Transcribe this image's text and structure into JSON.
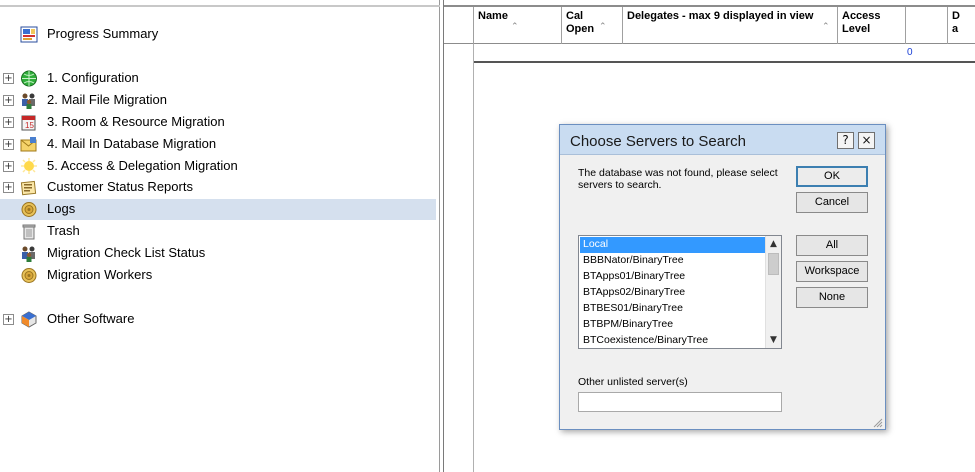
{
  "navigator": {
    "items": [
      {
        "label": "Progress Summary",
        "icon": "progress-summary-icon",
        "expandable": false,
        "selected": false
      },
      {
        "label": "1. Configuration",
        "icon": "configuration-globe-icon",
        "expandable": true,
        "selected": false
      },
      {
        "label": "2. Mail File Migration",
        "icon": "mail-file-people-icon",
        "expandable": true,
        "selected": false
      },
      {
        "label": "3. Room & Resource Migration",
        "icon": "room-resource-icon",
        "expandable": true,
        "selected": false
      },
      {
        "label": "4. Mail In Database Migration",
        "icon": "mail-in-database-icon",
        "expandable": true,
        "selected": false
      },
      {
        "label": "5. Access & Delegation Migration",
        "icon": "access-delegation-icon",
        "expandable": true,
        "selected": false
      },
      {
        "label": "Customer Status Reports",
        "icon": "status-reports-icon",
        "expandable": true,
        "selected": false
      },
      {
        "label": "Logs",
        "icon": "logs-icon",
        "expandable": false,
        "selected": true
      },
      {
        "label": "Trash",
        "icon": "trash-icon",
        "expandable": false,
        "selected": false
      },
      {
        "label": "Migration Check List Status",
        "icon": "check-list-people-icon",
        "expandable": false,
        "selected": false
      },
      {
        "label": "Migration Workers",
        "icon": "migration-workers-icon",
        "expandable": false,
        "selected": false
      },
      {
        "label": "Other Software",
        "icon": "other-software-icon",
        "expandable": true,
        "selected": false
      }
    ],
    "expander_symbol": "+",
    "selection_color": "#d5e0ee"
  },
  "grid": {
    "columns": [
      {
        "label": "Name"
      },
      {
        "label": "Cal Open"
      },
      {
        "label": "Delegates - max 9 displayed in view"
      },
      {
        "label": "Access Level"
      },
      {
        "label": ""
      },
      {
        "label": "D a"
      }
    ],
    "sort_arrow": "⌃",
    "total_value": "0"
  },
  "dialog": {
    "title": "Choose Servers to Search",
    "help_button": "?",
    "close_button": "×",
    "message": "The database was not found, please select servers to search.",
    "buttons": {
      "ok": "OK",
      "cancel": "Cancel",
      "all": "All",
      "workspace": "Workspace",
      "none": "None"
    },
    "servers": [
      "Local",
      "BBBNator/BinaryTree",
      "BTApps01/BinaryTree",
      "BTApps02/BinaryTree",
      "BTBES01/BinaryTree",
      "BTBPM/BinaryTree",
      "BTCoexistence/BinaryTree"
    ],
    "selected_server": "Local",
    "scroll_up": "▲",
    "scroll_down": "▼",
    "other_label": "Other unlisted server(s)",
    "other_value": "",
    "title_bar_color": "#c9dcf1",
    "selection_color": "#3399ff"
  }
}
